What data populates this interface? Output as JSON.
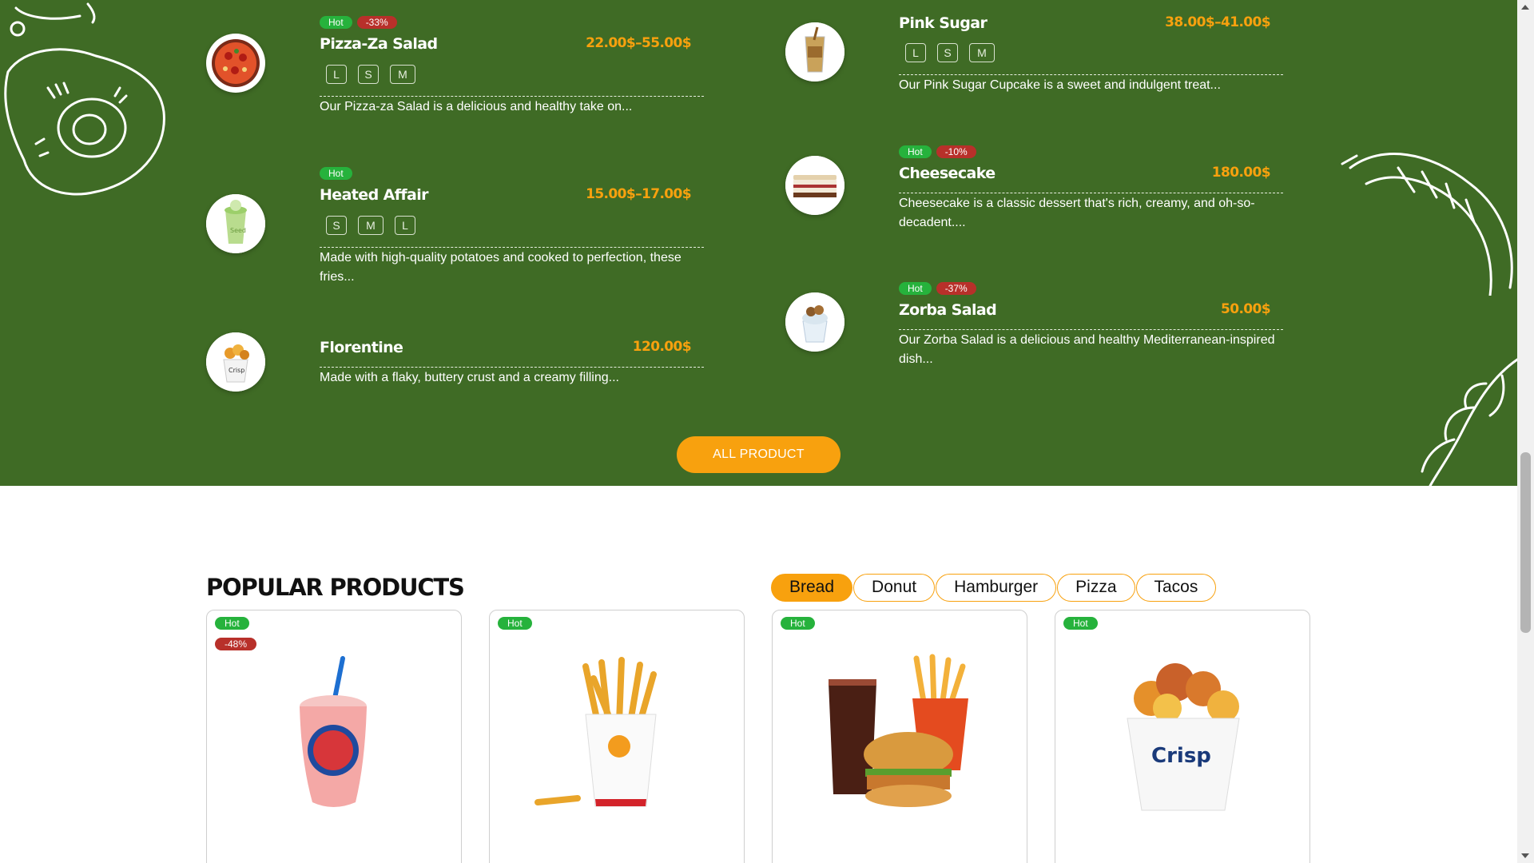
{
  "menu": {
    "items": [
      {
        "tags": [
          "Hot",
          "-33%"
        ],
        "name": "Pizza-Za Salad",
        "price": "22.00$–55.00$",
        "sizes": [
          "L",
          "S",
          "M"
        ],
        "desc": "Our Pizza-za Salad is a delicious and healthy take on..."
      },
      {
        "tags": [
          "Hot"
        ],
        "name": "Heated Affair",
        "price": "15.00$–17.00$",
        "sizes": [
          "S",
          "M",
          "L"
        ],
        "desc": "Made with high-quality potatoes and cooked to perfection, these fries..."
      },
      {
        "tags": [],
        "name": "Florentine",
        "price": "120.00$",
        "sizes": [],
        "desc": "Made with a flaky, buttery crust and a creamy filling..."
      },
      {
        "tags": [],
        "name": "Pink Sugar",
        "price": "38.00$–41.00$",
        "sizes": [
          "L",
          "S",
          "M"
        ],
        "desc": "Our Pink Sugar Cupcake is a sweet and indulgent treat..."
      },
      {
        "tags": [
          "Hot",
          "-10%"
        ],
        "name": "Cheesecake",
        "price": "180.00$",
        "sizes": [],
        "desc": "Cheesecake is a classic dessert that's rich, creamy, and oh-so-decadent...."
      },
      {
        "tags": [
          "Hot",
          "-37%"
        ],
        "name": "Zorba Salad",
        "price": "50.00$",
        "sizes": [],
        "desc": "Our Zorba Salad is a delicious and healthy Mediterranean-inspired dish..."
      }
    ],
    "all_product_label": "ALL PRODUCT"
  },
  "popular": {
    "title": "POPULAR PRODUCTS",
    "tabs": [
      "Bread",
      "Donut",
      "Hamburger",
      "Pizza",
      "Tacos"
    ],
    "active_tab": "Bread",
    "cards": [
      {
        "tags": [
          "Hot",
          "-48%"
        ],
        "image": "pink-slushie-cup"
      },
      {
        "tags": [
          "Hot"
        ],
        "image": "fries-cup"
      },
      {
        "tags": [
          "Hot"
        ],
        "image": "burger-combo"
      },
      {
        "tags": [
          "Hot"
        ],
        "image": "crispy-chicken-bucket"
      }
    ]
  },
  "colors": {
    "menu_bg": "#3f6b25",
    "accent": "#f8a10e",
    "hot": "#26b23c",
    "sale": "#b8302a"
  }
}
